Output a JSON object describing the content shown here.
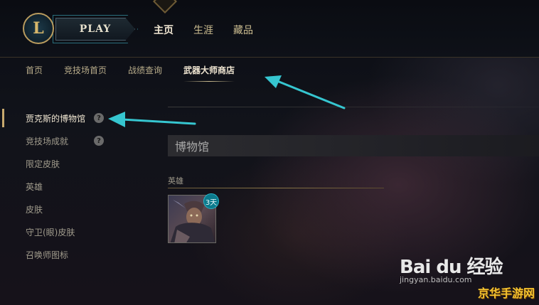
{
  "header": {
    "logo_letter": "L",
    "play_label": "PLAY",
    "main_nav": [
      {
        "label": "主页",
        "active": true
      },
      {
        "label": "生涯",
        "active": false
      },
      {
        "label": "藏品",
        "active": false
      }
    ]
  },
  "sub_nav": [
    {
      "label": "首页",
      "active": false
    },
    {
      "label": "竞技场首页",
      "active": false
    },
    {
      "label": "战绩查询",
      "active": false
    },
    {
      "label": "武器大师商店",
      "active": true
    }
  ],
  "sidebar": {
    "items": [
      {
        "label": "贾克斯的博物馆",
        "active": true,
        "help": "?"
      },
      {
        "label": "竞技场成就",
        "active": false,
        "help": "?"
      },
      {
        "label": "限定皮肤",
        "active": false
      },
      {
        "label": "英雄",
        "active": false
      },
      {
        "label": "皮肤",
        "active": false
      },
      {
        "label": "守卫(眼)皮肤",
        "active": false
      },
      {
        "label": "召唤师图标",
        "active": false
      }
    ]
  },
  "main": {
    "section_title": "博物馆",
    "category_label": "英雄",
    "champion": {
      "rental_badge": "3天"
    }
  },
  "watermark": {
    "brand": "Bai du 经验",
    "url": "jingyan.baidu.com",
    "site": "京华手游网"
  },
  "colors": {
    "gold": "#cdbe91",
    "accent_teal": "#29b3c6",
    "arrow": "#36c6d0"
  }
}
